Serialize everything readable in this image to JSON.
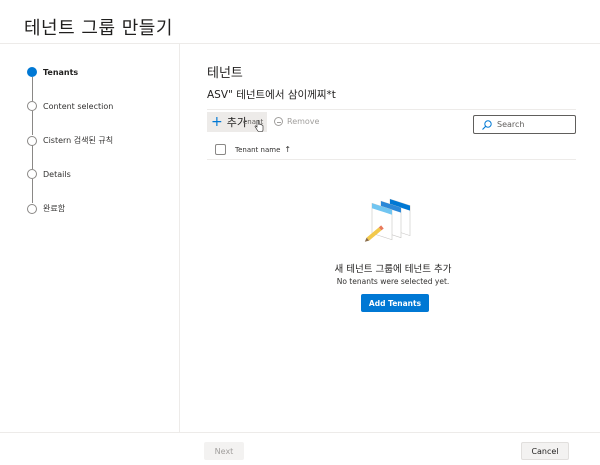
{
  "window": {
    "title": "테넌트 그룹 만들기"
  },
  "steps": [
    {
      "label": "Tenants",
      "active": true
    },
    {
      "label": "Content selection",
      "active": false
    },
    {
      "label": "Cistern 검색된 규칙",
      "active": false
    },
    {
      "label": "Details",
      "active": false
    },
    {
      "label": "완료함",
      "active": false
    }
  ],
  "main": {
    "title": "테넌트",
    "subtitle": "ASV\" 테넌트에서 삼이께찌*t",
    "toolbar": {
      "add_label": "추가",
      "add_ghost": "enant",
      "remove_label": "Remove"
    },
    "search": {
      "placeholder": "Search"
    },
    "table": {
      "column_name": "Tenant name",
      "sort_glyph": "↑"
    },
    "empty": {
      "title": "새 테넌트 그룹에 테넌트 추가",
      "subtitle": "No tenants were selected yet.",
      "button": "Add Tenants"
    }
  },
  "footer": {
    "next_label": "Next",
    "cancel_label": "Cancel"
  },
  "colors": {
    "accent": "#0078d4",
    "divider": "#edebe9",
    "muted": "#a19f9d"
  },
  "icons": [
    "plus-icon",
    "remove-icon",
    "search-icon",
    "sort-arrow-icon",
    "hand-cursor-icon",
    "illustration-cards"
  ]
}
